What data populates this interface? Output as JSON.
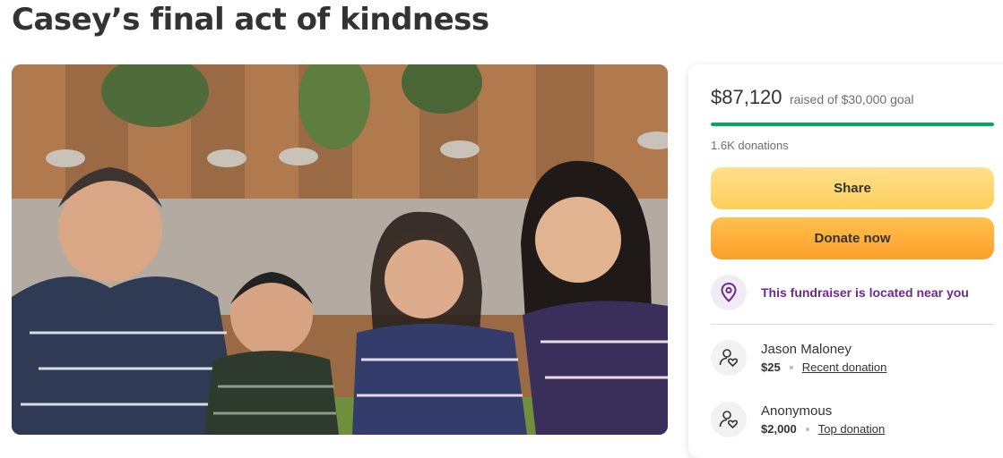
{
  "page": {
    "title": "Casey’s final act of kindness"
  },
  "hero": {
    "image": "family-photo"
  },
  "summary": {
    "raised_amount": "$87,120",
    "goal_text": "raised of $30,000 goal",
    "progress_fraction": 1.0,
    "donation_count": "1.6K donations"
  },
  "actions": {
    "share_label": "Share",
    "donate_label": "Donate now"
  },
  "location": {
    "icon": "location-pin-icon",
    "text": "This fundraiser is located near you"
  },
  "donations": [
    {
      "name": "Jason Maloney",
      "amount": "$25",
      "tag": "Recent donation",
      "icon": "donor-heart-icon"
    },
    {
      "name": "Anonymous",
      "amount": "$2,000",
      "tag": "Top donation",
      "icon": "donor-heart-icon"
    }
  ],
  "colors": {
    "progress": "#02a95c",
    "share_button": "#fcd46a",
    "donate_button": "#fdaa35",
    "location_text": "#6e2a87",
    "text": "#333333"
  }
}
